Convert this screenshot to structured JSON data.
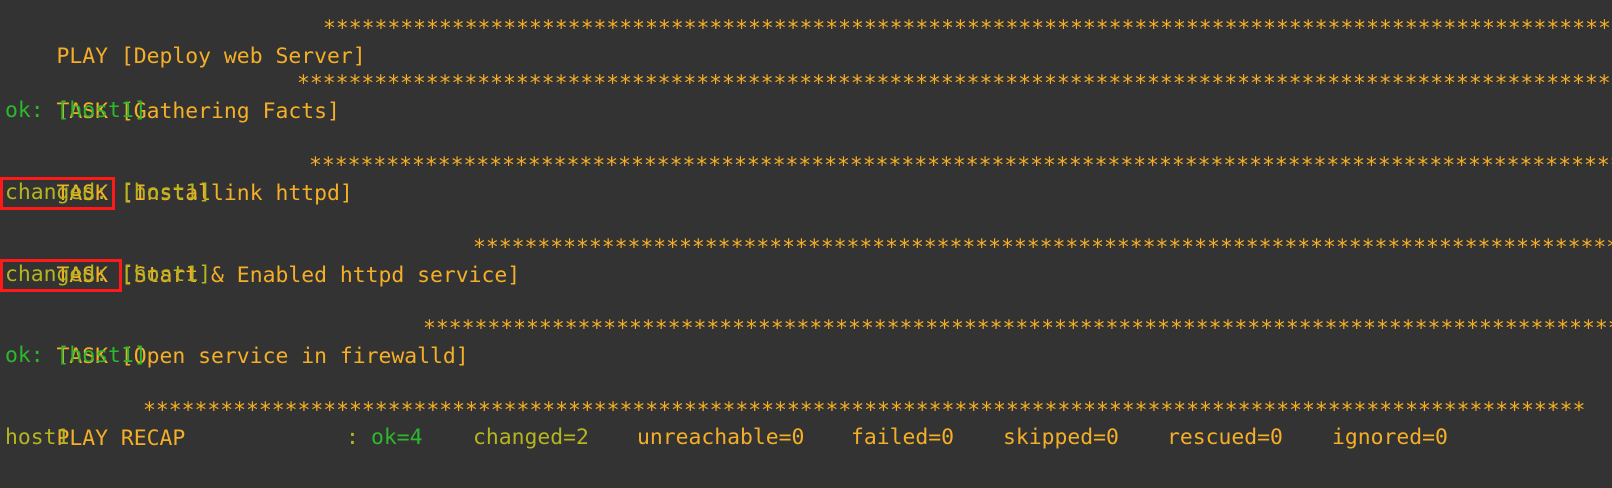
{
  "play": {
    "title": "PLAY [Deploy web Server]",
    "stars": "****************************************************************************************************************"
  },
  "tasks": [
    {
      "header": "TASK [Gathering Facts]",
      "status": "ok:",
      "host": "[host1]"
    },
    {
      "header": "TASK [Installink httpd]",
      "status": "changed:",
      "host": "[host1]"
    },
    {
      "header": "TASK [Start & Enabled httpd service]",
      "status": "changed:",
      "host": "[host1]"
    },
    {
      "header": "TASK [Open service in firewalld]",
      "status": "ok:",
      "host": "[host1]"
    }
  ],
  "recap": {
    "title": "PLAY RECAP",
    "host": "host1",
    "colon": ":",
    "ok": "ok=4",
    "changed": "changed=2",
    "unreachable": "unreachable=0",
    "failed": "failed=0",
    "skipped": "skipped=0",
    "rescued": "rescued=0",
    "ignored": "ignored=0"
  },
  "colors": {
    "background": "#333333",
    "header": "#f5ae27",
    "ok": "#2cb82c",
    "changed": "#b5b520",
    "highlight": "#ff1a1a"
  }
}
